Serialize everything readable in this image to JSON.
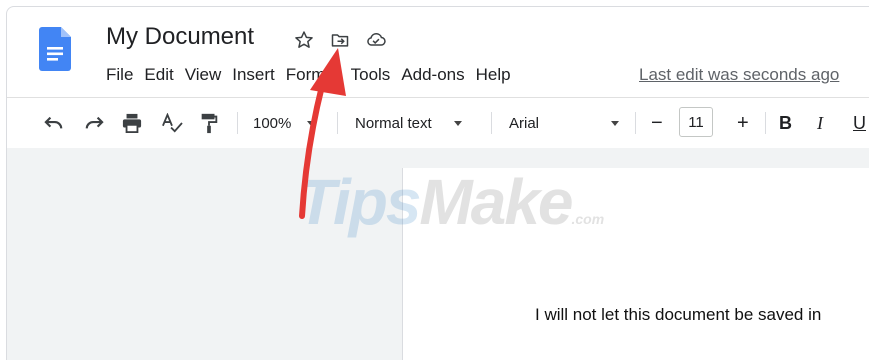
{
  "header": {
    "title": "My Document",
    "title_icons": [
      "star-icon",
      "move-to-folder-icon",
      "cloud-status-icon"
    ],
    "last_edit": "Last edit was seconds ago"
  },
  "menu": {
    "file": "File",
    "edit": "Edit",
    "view": "View",
    "insert": "Insert",
    "format": "Format",
    "tools": "Tools",
    "addons": "Add-ons",
    "help": "Help"
  },
  "toolbar": {
    "zoom": "100%",
    "style": "Normal text",
    "font": "Arial",
    "minus": "−",
    "font_size": "11",
    "plus": "+",
    "bold": "B",
    "italic": "I",
    "underline": "U",
    "icons": [
      "undo-icon",
      "redo-icon",
      "print-icon",
      "spellcheck-icon",
      "paint-format-icon"
    ]
  },
  "document": {
    "body_text": "I will not let this document be saved in"
  },
  "watermark": {
    "tips": "Tips",
    "make": "Make",
    "com": ".com"
  },
  "colors": {
    "docs_blue": "#4285f4",
    "arrow_red": "#e53935"
  }
}
